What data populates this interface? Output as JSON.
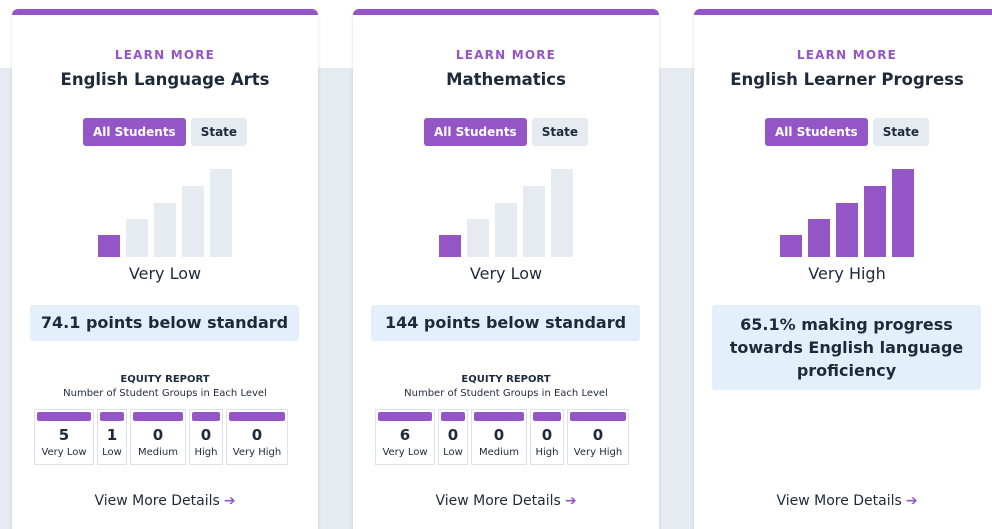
{
  "colors": {
    "accent": "#9456c7",
    "muted": "#e6ebf2",
    "status_bg": "#e3effb"
  },
  "cards": [
    {
      "learn_more": "LEARN MORE",
      "title": "English Language Arts",
      "toggle": {
        "active": "All Students",
        "inactive": "State"
      },
      "level_bars_filled": 1,
      "level_label": "Very Low",
      "status": "74.1 points below standard",
      "equity": {
        "title": "EQUITY REPORT",
        "subtitle": "Number of Student Groups in Each Level",
        "levels": [
          {
            "count": "5",
            "label": "Very Low"
          },
          {
            "count": "1",
            "label": "Low"
          },
          {
            "count": "0",
            "label": "Medium"
          },
          {
            "count": "0",
            "label": "High"
          },
          {
            "count": "0",
            "label": "Very High"
          }
        ]
      },
      "view_more": "View More Details",
      "view_more_icon": "arrow-right-icon"
    },
    {
      "learn_more": "LEARN MORE",
      "title": "Mathematics",
      "toggle": {
        "active": "All Students",
        "inactive": "State"
      },
      "level_bars_filled": 1,
      "level_label": "Very Low",
      "status": "144 points below standard",
      "equity": {
        "title": "EQUITY REPORT",
        "subtitle": "Number of Student Groups in Each Level",
        "levels": [
          {
            "count": "6",
            "label": "Very Low"
          },
          {
            "count": "0",
            "label": "Low"
          },
          {
            "count": "0",
            "label": "Medium"
          },
          {
            "count": "0",
            "label": "High"
          },
          {
            "count": "0",
            "label": "Very High"
          }
        ]
      },
      "view_more": "View More Details",
      "view_more_icon": "arrow-right-icon"
    },
    {
      "learn_more": "LEARN MORE",
      "title": "English Learner Progress",
      "toggle": {
        "active": "All Students",
        "inactive": "State"
      },
      "level_bars_filled": 5,
      "level_label": "Very High",
      "status_lines": [
        "65.1% making progress",
        "towards English language",
        "proficiency"
      ],
      "view_more": "View More Details",
      "view_more_icon": "arrow-right-icon"
    }
  ]
}
